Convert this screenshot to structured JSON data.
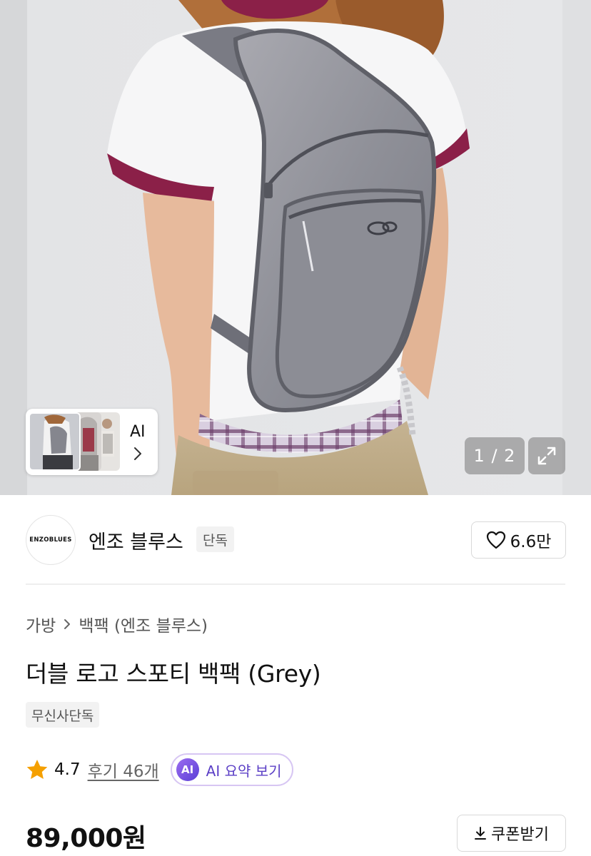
{
  "gallery": {
    "page_indicator": "1 / 2",
    "ai_label": "AI"
  },
  "brand": {
    "name": "엔조 블루스",
    "logo_text": "ENZOBLUES",
    "badge": "단독",
    "likes": "6.6만"
  },
  "product": {
    "breadcrumb": [
      "가방",
      "백팩 (엔조 블루스)"
    ],
    "title": "더블 로고 스포티 백팩 (Grey)",
    "tag": "무신사단독",
    "rating": "4.7",
    "reviews_label": "후기 46개",
    "ai_summary_badge": "AI",
    "ai_summary_label": "AI 요약 보기",
    "price": "89,000원",
    "coupon_label": "쿠폰받기"
  },
  "icons": {
    "expand": "expand-icon",
    "chevron": "chevron-right-icon",
    "heart": "heart-icon",
    "star": "star-icon",
    "download": "download-icon"
  },
  "colors": {
    "star": "#F5A000",
    "ai_accent": "#5B3FC6",
    "ai_border": "#D7C6F3"
  }
}
